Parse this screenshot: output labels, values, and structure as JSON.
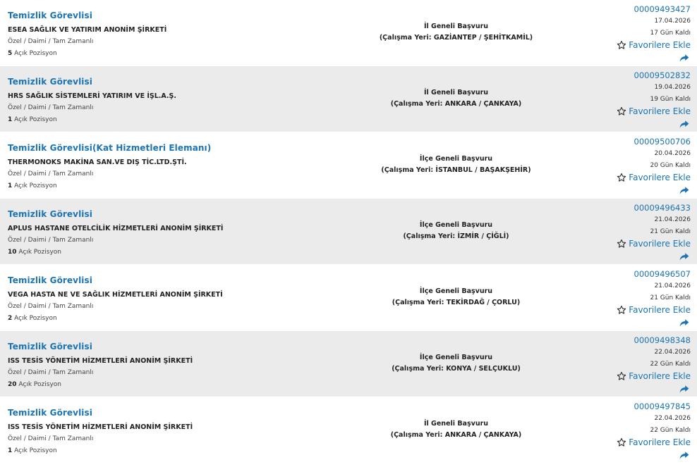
{
  "accent_color": "#1a74b5",
  "row_alt_color": "#ebebeb",
  "favorite_label": "Favorilere Ekle",
  "position_suffix": "Açık Pozisyon",
  "jobs": [
    {
      "title": "Temizlik Görevlisi",
      "company": "ESEA SAĞLIK VE YATIRIM ANONİM ŞİRKETİ",
      "type": "Özel / Daimi / Tam Zamanlı",
      "positions": "5",
      "scope": "İl Geneli Başvuru",
      "place": "(Çalışma Yeri: GAZİANTEP / ŞEHİTKAMİL)",
      "job_no": "00009493427",
      "date": "17.04.2026",
      "days_left": "17 Gün Kaldı"
    },
    {
      "title": "Temizlik Görevlisi",
      "company": "HRS SAĞLIK SİSTEMLERİ YATIRIM VE İŞL.A.Ş.",
      "type": "Özel / Daimi / Tam Zamanlı",
      "positions": "1",
      "scope": "İl Geneli Başvuru",
      "place": "(Çalışma Yeri: ANKARA / ÇANKAYA)",
      "job_no": "00009502832",
      "date": "19.04.2026",
      "days_left": "19 Gün Kaldı"
    },
    {
      "title": "Temizlik Görevlisi(Kat Hizmetleri Elemanı)",
      "company": "THERMONOKS MAKİNA SAN.VE DIŞ TİC.LTD.ŞTİ.",
      "type": "Özel / Daimi / Tam Zamanlı",
      "positions": "1",
      "scope": "İlçe Geneli Başvuru",
      "place": "(Çalışma Yeri: İSTANBUL / BAŞAKŞEHİR)",
      "job_no": "00009500706",
      "date": "20.04.2026",
      "days_left": "20 Gün Kaldı"
    },
    {
      "title": "Temizlik Görevlisi",
      "company": "APLUS HASTANE OTELCİLİK HİZMETLERİ ANONİM ŞİRKETİ",
      "type": "Özel / Daimi / Tam Zamanlı",
      "positions": "10",
      "scope": "İlçe Geneli Başvuru",
      "place": "(Çalışma Yeri: İZMİR / ÇİĞLİ)",
      "job_no": "00009496433",
      "date": "21.04.2026",
      "days_left": "21 Gün Kaldı"
    },
    {
      "title": "Temizlik Görevlisi",
      "company": "VEGA HASTA NE VE SAĞLIK HİZMETLERİ ANONİM ŞİRKETİ",
      "type": "Özel / Daimi / Tam Zamanlı",
      "positions": "2",
      "scope": "İlçe Geneli Başvuru",
      "place": "(Çalışma Yeri: TEKİRDAĞ / ÇORLU)",
      "job_no": "00009496507",
      "date": "21.04.2026",
      "days_left": "21 Gün Kaldı"
    },
    {
      "title": "Temizlik Görevlisi",
      "company": "ISS TESİS YÖNETİM HİZMETLERİ ANONİM ŞİRKETİ",
      "type": "Özel / Daimi / Tam Zamanlı",
      "positions": "20",
      "scope": "İlçe Geneli Başvuru",
      "place": "(Çalışma Yeri: KONYA / SELÇUKLU)",
      "job_no": "00009498348",
      "date": "22.04.2026",
      "days_left": "22 Gün Kaldı"
    },
    {
      "title": "Temizlik Görevlisi",
      "company": "ISS TESİS YÖNETİM HİZMETLERİ ANONİM ŞİRKETİ",
      "type": "Özel / Daimi / Tam Zamanlı",
      "positions": "1",
      "scope": "İl Geneli Başvuru",
      "place": "(Çalışma Yeri: ANKARA / ÇANKAYA)",
      "job_no": "00009497845",
      "date": "22.04.2026",
      "days_left": "22 Gün Kaldı"
    }
  ]
}
